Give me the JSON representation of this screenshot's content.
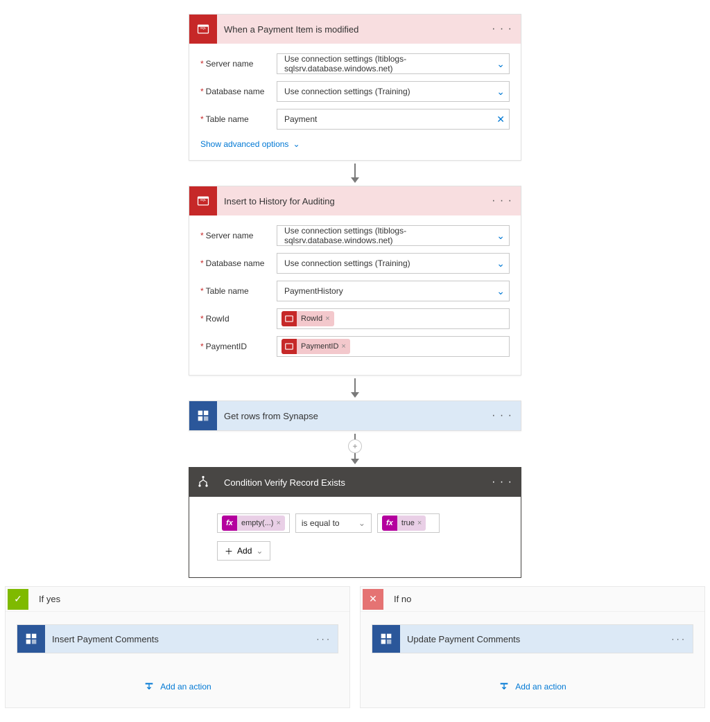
{
  "trigger": {
    "title": "When a Payment Item is modified",
    "fields": {
      "server_label": "Server name",
      "server_value": "Use connection settings (ltiblogs-sqlsrv.database.windows.net)",
      "database_label": "Database name",
      "database_value": "Use connection settings (Training)",
      "table_label": "Table name",
      "table_value": "Payment"
    },
    "advanced_link": "Show advanced options"
  },
  "insert_history": {
    "title": "Insert to History for Auditing",
    "fields": {
      "server_label": "Server name",
      "server_value": "Use connection settings (ltiblogs-sqlsrv.database.windows.net)",
      "database_label": "Database name",
      "database_value": "Use connection settings (Training)",
      "table_label": "Table name",
      "table_value": "PaymentHistory",
      "rowid_label": "RowId",
      "rowid_token": "RowId",
      "paymentid_label": "PaymentID",
      "paymentid_token": "PaymentID"
    }
  },
  "get_rows": {
    "title": "Get rows from Synapse"
  },
  "condition": {
    "title": "Condition Verify Record Exists",
    "left_token": "empty(...)",
    "operator": "is equal to",
    "right_token": "true",
    "add_label": "Add"
  },
  "branches": {
    "yes_label": "If yes",
    "no_label": "If no",
    "yes_action_title": "Insert Payment Comments",
    "no_action_title": "Update Payment Comments",
    "add_action_label": "Add an action"
  }
}
